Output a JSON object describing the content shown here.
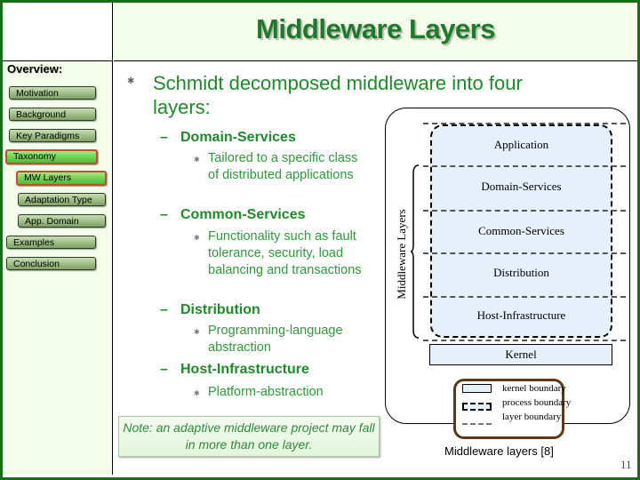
{
  "header": {
    "title": "Middleware Layers"
  },
  "sidebar": {
    "heading": "Overview:",
    "items": [
      {
        "label": "Motivation",
        "active": false
      },
      {
        "label": "Background",
        "active": false
      },
      {
        "label": "Key Paradigms",
        "active": false
      },
      {
        "label": "Taxonomy",
        "active": true
      },
      {
        "label": "MW Layers",
        "active": true
      },
      {
        "label": "Adaptation Type",
        "active": false
      },
      {
        "label": "App. Domain",
        "active": false
      },
      {
        "label": "Examples",
        "active": false
      },
      {
        "label": "Conclusion",
        "active": false
      }
    ]
  },
  "content": {
    "main_bullet": "Schmidt decomposed middleware into four layers:",
    "layers": [
      {
        "name": "Domain-Services",
        "detail": "Tailored to a specific class of distributed applications"
      },
      {
        "name": "Common-Services",
        "detail": "Functionality such as fault tolerance, security, load balancing and transactions"
      },
      {
        "name": "Distribution",
        "detail": "Programming-language abstraction"
      },
      {
        "name": "Host-Infrastructure",
        "detail": "Platform-abstraction"
      }
    ],
    "note": "Note: an adaptive middleware project may fall in more than one layer."
  },
  "diagram": {
    "layers": [
      "Application",
      "Domain-Services",
      "Common-Services",
      "Distribution",
      "Host-Infrastructure"
    ],
    "kernel": "Kernel",
    "brace_label": "Middleware Layers",
    "legend": [
      "kernel boundary",
      "process boundary",
      "layer boundary"
    ],
    "caption": "Middleware layers [8]"
  },
  "footer": {
    "page_number": "11"
  }
}
